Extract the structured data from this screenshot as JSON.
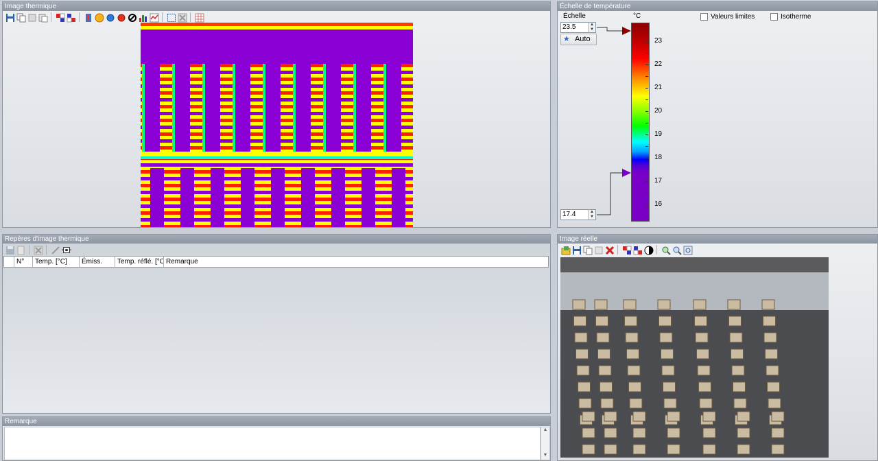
{
  "thermal_panel": {
    "title": "Image thermique"
  },
  "scale_panel": {
    "title": "Échelle de température",
    "echelle_label": "Échelle",
    "unit": "°C",
    "max_value": "23.5",
    "min_value": "17.4",
    "auto_label": "Auto",
    "ticks": [
      "23",
      "22",
      "21",
      "20",
      "19",
      "18",
      "17",
      "16"
    ],
    "valeurs_limites_label": "Valeurs limites",
    "isotherme_label": "Isotherme",
    "valeurs_limites_checked": false,
    "isotherme_checked": false
  },
  "markers_panel": {
    "title": "Repères d'image thermique",
    "columns": [
      "N°",
      "Temp. [°C]",
      "Émiss.",
      "Temp. réflé. [°C",
      "Remarque"
    ]
  },
  "remark_panel": {
    "title": "Remarque",
    "value": ""
  },
  "real_panel": {
    "title": "Image réelle"
  },
  "colors": {
    "palette": [
      "#8b0000",
      "#ff0000",
      "#ffa500",
      "#ffff00",
      "#00ff00",
      "#00bfff",
      "#0000ff",
      "#7a00c8"
    ],
    "thermal_base": "#8a00d4"
  },
  "icons": {
    "thermal_toolbar": [
      "save-icon",
      "copy-icon",
      "cut-icon",
      "paste-icon",
      "palette-icon",
      "palette-swap-icon",
      "thermometer-icon",
      "hotspot-icon",
      "coldspot-icon",
      "spot-icon",
      "no-measure-icon",
      "histogram-icon",
      "profile-icon",
      "select-area-icon",
      "delete-area-icon",
      "grid-icon"
    ],
    "markers_toolbar": [
      "save-icon",
      "copy-icon",
      "delete-icon",
      "pen-icon",
      "export-icon"
    ],
    "real_toolbar": [
      "open-icon",
      "save-icon",
      "copy-icon",
      "paste-icon",
      "delete-icon",
      "palette-icon",
      "palette-swap-icon",
      "contrast-icon",
      "zoom-in-icon",
      "zoom-out-icon",
      "zoom-fit-icon"
    ]
  }
}
